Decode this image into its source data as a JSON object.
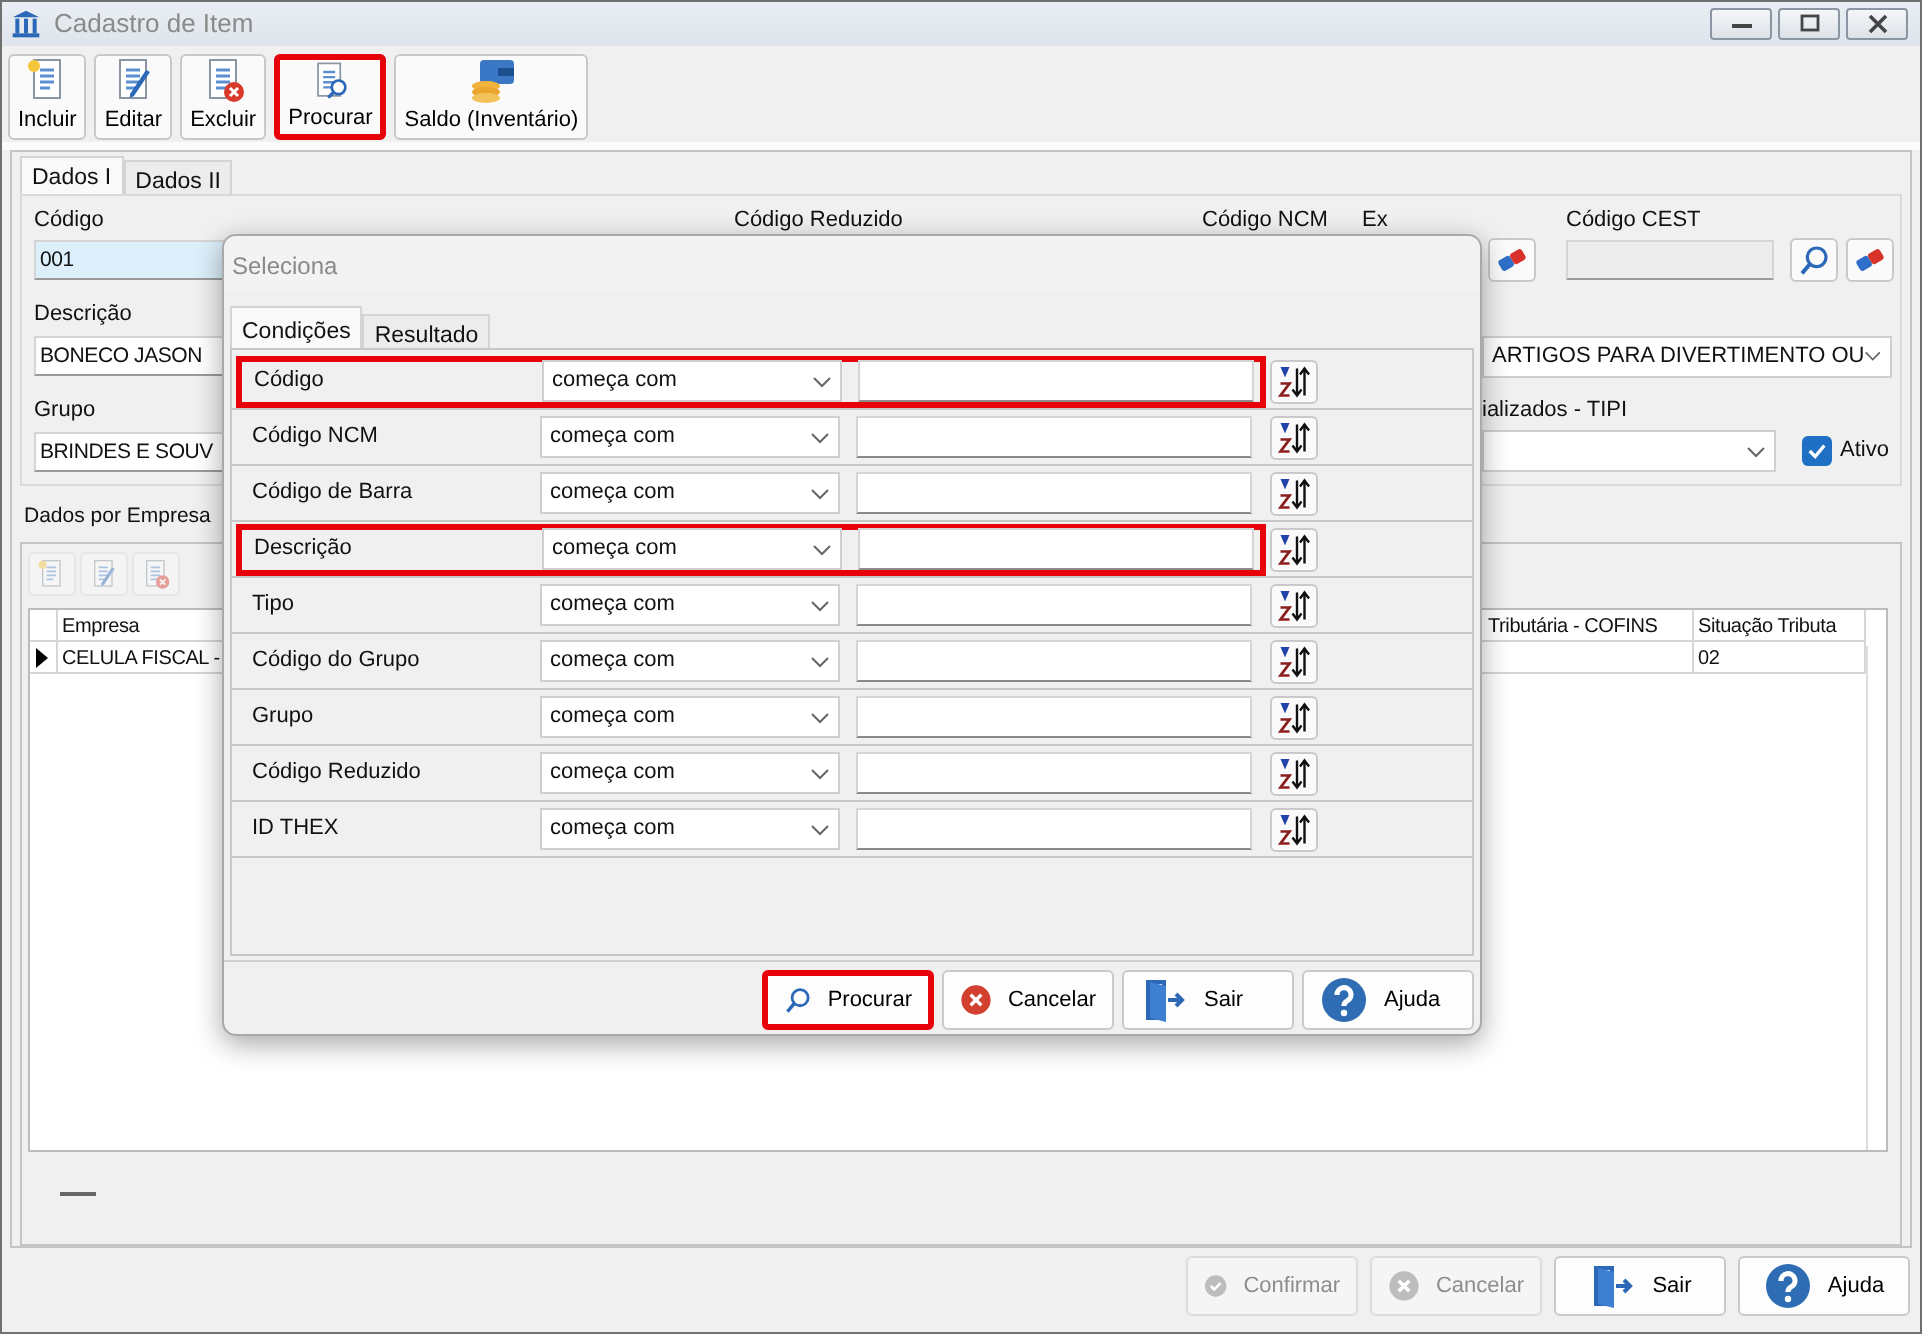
{
  "window": {
    "title": "Cadastro de Item"
  },
  "toolbar": [
    {
      "label": "Incluir",
      "kind": "new",
      "highlighted": false
    },
    {
      "label": "Editar",
      "kind": "edit",
      "highlighted": false
    },
    {
      "label": "Excluir",
      "kind": "delete",
      "highlighted": false
    },
    {
      "label": "Procurar",
      "kind": "search",
      "highlighted": true
    },
    {
      "label": "Saldo (Inventário)",
      "kind": "wallet",
      "highlighted": false
    }
  ],
  "tabs": [
    {
      "label": "Dados I",
      "selected": true
    },
    {
      "label": "Dados II",
      "selected": false
    }
  ],
  "form": {
    "codigo": {
      "label": "Código",
      "value": "001"
    },
    "codigo_reduzido": {
      "label": "Código Reduzido"
    },
    "codigo_ncm": {
      "label": "Código NCM"
    },
    "ex": {
      "label": "Ex"
    },
    "codigo_cest": {
      "label": "Código CEST",
      "disabled": true
    },
    "descricao": {
      "label": "Descrição",
      "value": "BONECO JASON"
    },
    "ncm_descricao": {
      "value": "ARTIGOS PARA DIVERTIMENTO OU"
    },
    "grupo": {
      "label": "Grupo",
      "value": "BRINDES E SOUV"
    },
    "tipi": {
      "label": "ializados - TIPI"
    },
    "ativo": {
      "label": "Ativo",
      "checked": true
    }
  },
  "company_section": {
    "title": "Dados por Empresa",
    "columns": [
      "Empresa",
      "Tributária - COFINS",
      "Situação Tributa"
    ],
    "rows": [
      {
        "empresa": "CELULA FISCAL -",
        "situacao": "02",
        "current": true
      }
    ]
  },
  "dialog": {
    "title": "Seleciona",
    "tabs": [
      {
        "label": "Condições",
        "selected": true
      },
      {
        "label": "Resultado",
        "selected": false
      }
    ],
    "conditions": [
      {
        "field": "Código",
        "operator": "começa com",
        "highlighted": true
      },
      {
        "field": "Código NCM",
        "operator": "começa com",
        "highlighted": false
      },
      {
        "field": "Código de Barra",
        "operator": "começa com",
        "highlighted": false
      },
      {
        "field": "Descrição",
        "operator": "começa com",
        "highlighted": true
      },
      {
        "field": "Tipo",
        "operator": "começa com",
        "highlighted": false
      },
      {
        "field": "Código do Grupo",
        "operator": "começa com",
        "highlighted": false
      },
      {
        "field": "Grupo",
        "operator": "começa com",
        "highlighted": false
      },
      {
        "field": "Código Reduzido",
        "operator": "começa com",
        "highlighted": false
      },
      {
        "field": "ID THEX",
        "operator": "começa com",
        "highlighted": false
      }
    ],
    "buttons": [
      {
        "label": "Procurar",
        "kind": "search",
        "highlighted": true
      },
      {
        "label": "Cancelar",
        "kind": "cancel",
        "highlighted": false
      },
      {
        "label": "Sair",
        "kind": "exit",
        "highlighted": false
      },
      {
        "label": "Ajuda",
        "kind": "help",
        "highlighted": false
      }
    ]
  },
  "footer_buttons": [
    {
      "label": "Confirmar",
      "kind": "confirm",
      "disabled": true
    },
    {
      "label": "Cancelar",
      "kind": "cancel",
      "disabled": true
    },
    {
      "label": "Sair",
      "kind": "exit",
      "disabled": false
    },
    {
      "label": "Ajuda",
      "kind": "help",
      "disabled": false
    }
  ]
}
